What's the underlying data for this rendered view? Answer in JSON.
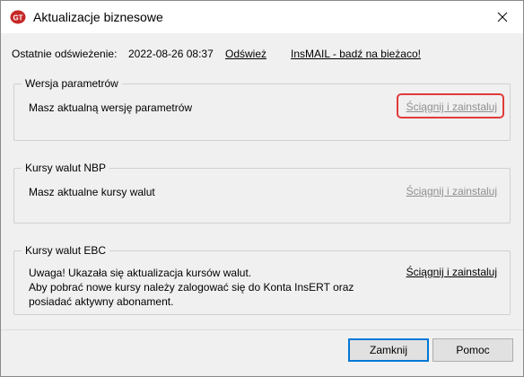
{
  "window": {
    "title": "Aktualizacje biznesowe",
    "close_symbol": "✕"
  },
  "refresh": {
    "label": "Ostatnie odświeżenie:",
    "timestamp": "2022-08-26 08:37",
    "refresh_link": "Odśwież",
    "insmail_link": "InsMAIL - badź na bieżaco!"
  },
  "groups": [
    {
      "title": "Wersja parametrów",
      "text": [
        "Masz aktualną wersję parametrów"
      ],
      "link": "Ściągnij i zainstaluj",
      "link_state": "disabled"
    },
    {
      "title": "Kursy walut NBP",
      "text": [
        "Masz aktualne kursy walut"
      ],
      "link": "Ściągnij i zainstaluj",
      "link_state": "disabled"
    },
    {
      "title": "Kursy walut EBC",
      "text": [
        "Uwaga! Ukazała się aktualizacja kursów walut.",
        "Aby pobrać nowe kursy należy zalogować się do Konta InsERT oraz",
        "posiadać aktywny abonament."
      ],
      "link": "Ściągnij i zainstaluj",
      "link_state": "active"
    }
  ],
  "buttons": {
    "close": "Zamknij",
    "help": "Pomoc"
  },
  "colors": {
    "highlight": "#e23a3a",
    "disabled_link": "#8f8f8f",
    "default_button_border": "#0078d7"
  }
}
